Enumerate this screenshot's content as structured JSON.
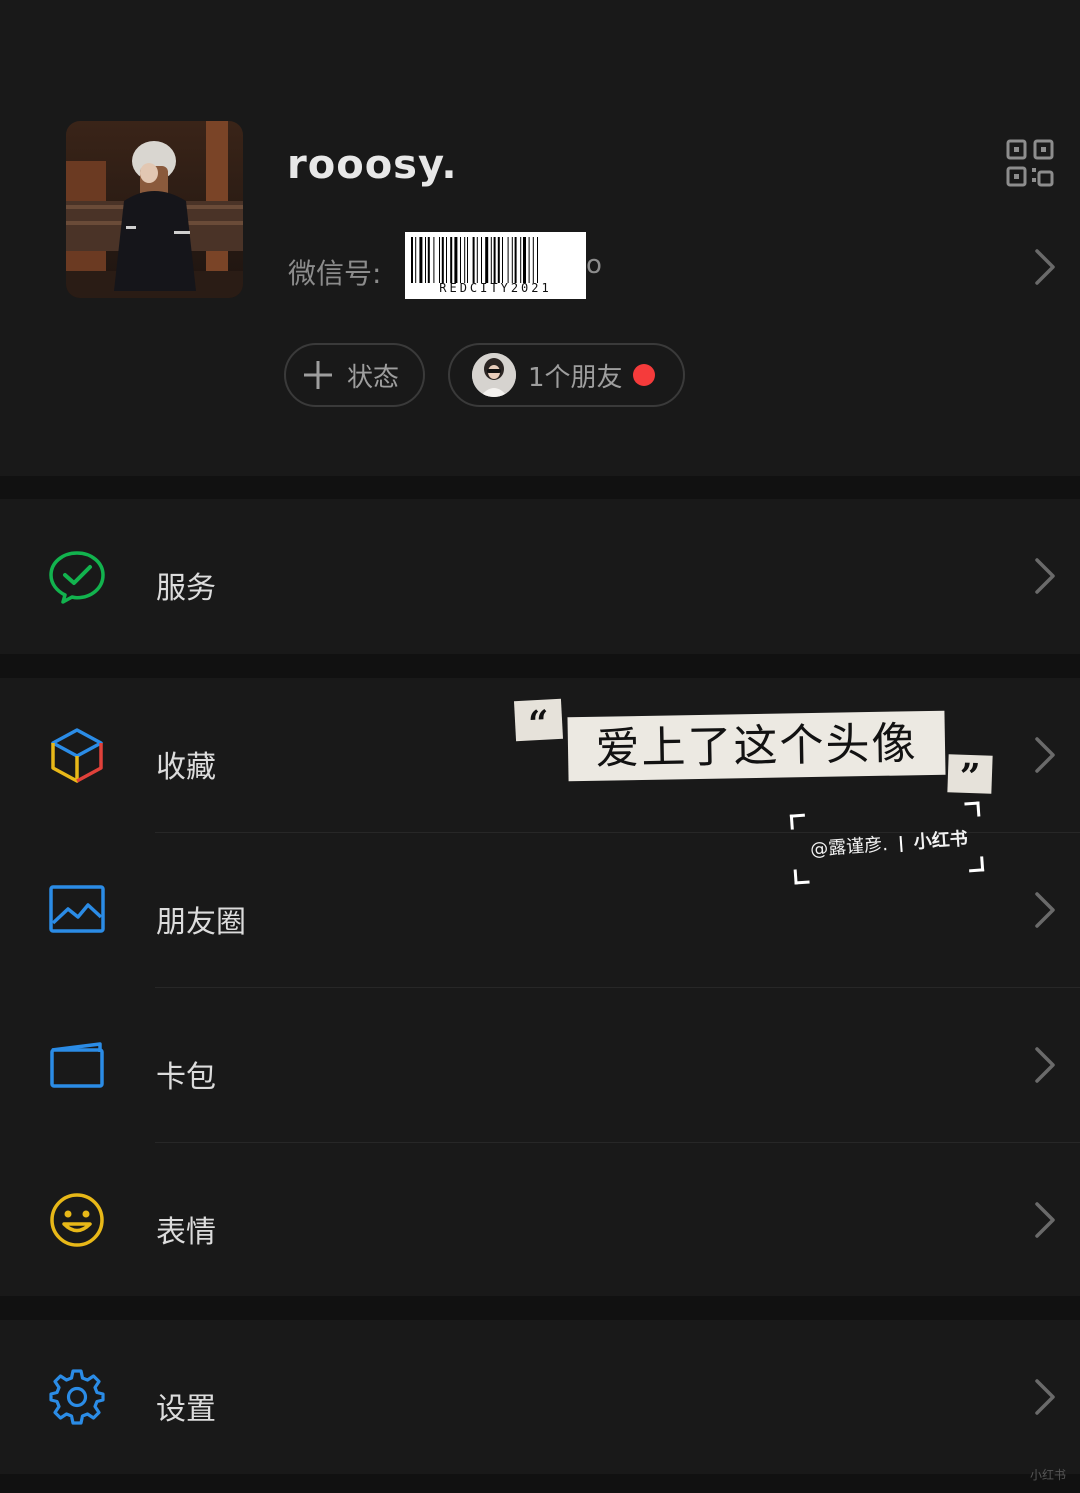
{
  "profile": {
    "nickname": "rooosy.",
    "wechat_id_label": "微信号:",
    "wechat_id_barcode_text": "REDCITY2021",
    "wechat_id_tail": "o",
    "qr_icon": "qr-code-icon",
    "status_button_label": "状态",
    "friends_label": "1个朋友",
    "new_dot_color": "#f53b3b"
  },
  "menu": {
    "services": {
      "label": "服务",
      "icon": "wechat-pay-icon",
      "color": "#12b34e"
    },
    "favorites": {
      "label": "收藏",
      "icon": "cube-icon"
    },
    "moments": {
      "label": "朋友圈",
      "icon": "image-icon",
      "color": "#2b8ce6"
    },
    "cards": {
      "label": "卡包",
      "icon": "wallet-icon",
      "color": "#2b8ce6"
    },
    "stickers": {
      "label": "表情",
      "icon": "smile-icon",
      "color": "#e8b818"
    },
    "settings": {
      "label": "设置",
      "icon": "gear-icon",
      "color": "#2b8ce6"
    }
  },
  "overlay": {
    "quote_open": "“",
    "quote_text": "爱上了这个头像",
    "quote_close": "”",
    "credit_author": "@露谨彦.",
    "credit_brand": "小红书",
    "corner_logo": "小红书"
  }
}
